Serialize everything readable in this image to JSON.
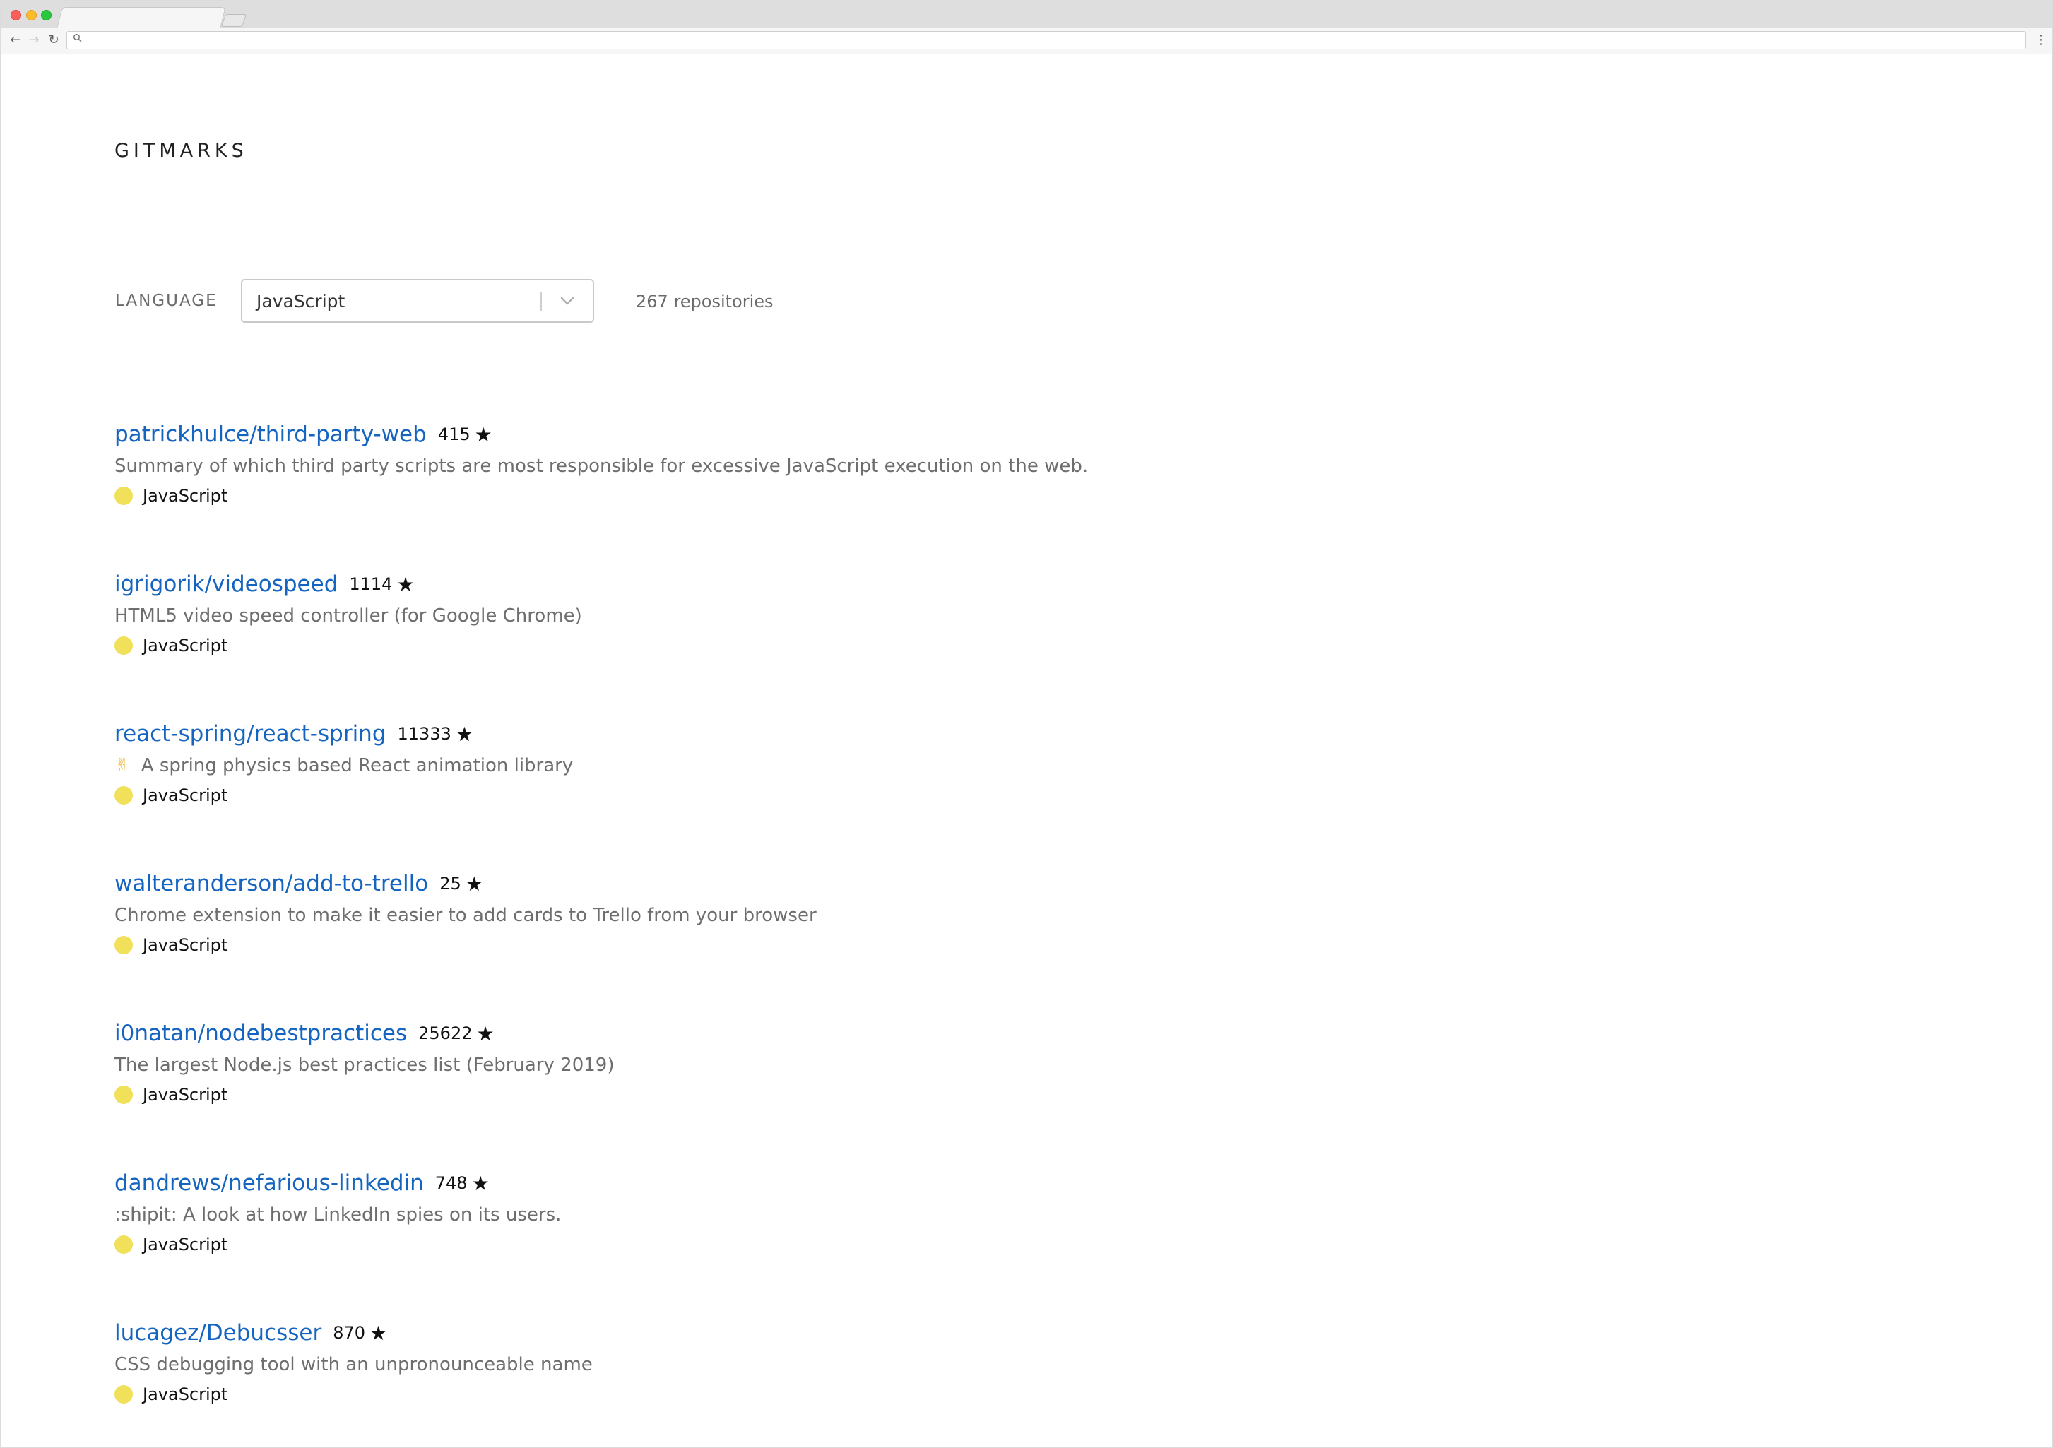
{
  "browser": {
    "url": ""
  },
  "header": {
    "brand": "GITMARKS"
  },
  "filter": {
    "label": "LANGUAGE",
    "selected": "JavaScript",
    "count_text": "267 repositories"
  },
  "colors": {
    "link": "#1565c0",
    "javascript_dot": "#f1e05a"
  },
  "repos": [
    {
      "name": "patrickhulce/third-party-web",
      "stars": "415",
      "emoji": "",
      "description": "Summary of which third party scripts are most responsible for excessive JavaScript execution on the web.",
      "language": "JavaScript"
    },
    {
      "name": "igrigorik/videospeed",
      "stars": "1114",
      "emoji": "",
      "description": "HTML5 video speed controller (for Google Chrome)",
      "language": "JavaScript"
    },
    {
      "name": "react-spring/react-spring",
      "stars": "11333",
      "emoji": "✌",
      "description": "A spring physics based React animation library",
      "language": "JavaScript"
    },
    {
      "name": "walteranderson/add-to-trello",
      "stars": "25",
      "emoji": "",
      "description": "Chrome extension to make it easier to add cards to Trello from your browser",
      "language": "JavaScript"
    },
    {
      "name": "i0natan/nodebestpractices",
      "stars": "25622",
      "emoji": "",
      "description": "The largest Node.js best practices list (February 2019)",
      "language": "JavaScript"
    },
    {
      "name": "dandrews/nefarious-linkedin",
      "stars": "748",
      "emoji": "",
      "description": ":shipit: A look at how LinkedIn spies on its users.",
      "language": "JavaScript"
    },
    {
      "name": "lucagez/Debucsser",
      "stars": "870",
      "emoji": "",
      "description": "CSS debugging tool with an unpronounceable name",
      "language": "JavaScript"
    }
  ]
}
